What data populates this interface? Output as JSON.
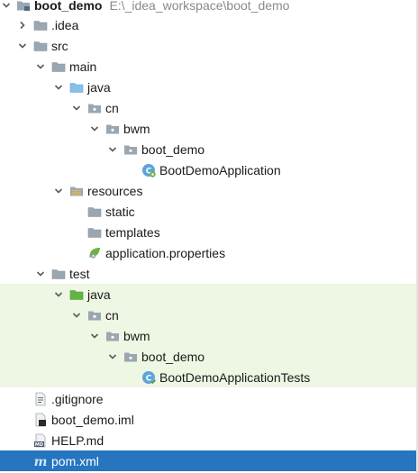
{
  "project_tree": {
    "rows": [
      {
        "label": "boot_demo",
        "path": "E:\\_idea_workspace\\boot_demo",
        "icon": "project-folder-icon",
        "expanded": true
      },
      {
        "label": ".idea",
        "icon": "folder-icon",
        "expanded": false
      },
      {
        "label": "src",
        "icon": "folder-icon",
        "expanded": true
      },
      {
        "label": "main",
        "icon": "folder-icon",
        "expanded": true
      },
      {
        "label": "java",
        "icon": "source-root-folder-icon",
        "expanded": true
      },
      {
        "label": "cn",
        "icon": "package-icon",
        "expanded": true
      },
      {
        "label": "bwm",
        "icon": "package-icon",
        "expanded": true
      },
      {
        "label": "boot_demo",
        "icon": "package-icon",
        "expanded": true
      },
      {
        "label": "BootDemoApplication",
        "icon": "spring-boot-class-icon"
      },
      {
        "label": "resources",
        "icon": "resources-folder-icon",
        "expanded": true
      },
      {
        "label": "static",
        "icon": "folder-icon"
      },
      {
        "label": "templates",
        "icon": "folder-icon"
      },
      {
        "label": "application.properties",
        "icon": "spring-properties-icon"
      },
      {
        "label": "test",
        "icon": "folder-icon",
        "expanded": true
      },
      {
        "label": "java",
        "icon": "test-root-folder-icon",
        "expanded": true
      },
      {
        "label": "cn",
        "icon": "package-icon",
        "expanded": true
      },
      {
        "label": "bwm",
        "icon": "package-icon",
        "expanded": true
      },
      {
        "label": "boot_demo",
        "icon": "package-icon",
        "expanded": true
      },
      {
        "label": "BootDemoApplicationTests",
        "icon": "test-class-icon"
      },
      {
        "label": ".gitignore",
        "icon": "text-file-icon"
      },
      {
        "label": "boot_demo.iml",
        "icon": "iml-file-icon"
      },
      {
        "label": "HELP.md",
        "icon": "markdown-file-icon"
      },
      {
        "label": "pom.xml",
        "icon": "maven-file-icon",
        "selected": true
      }
    ]
  },
  "colors": {
    "selection": "#2675bf",
    "test_source_background": "#eef6e4",
    "folder": "#9aa7b0",
    "source_root": "#87bfe6",
    "test_root": "#62b543"
  }
}
